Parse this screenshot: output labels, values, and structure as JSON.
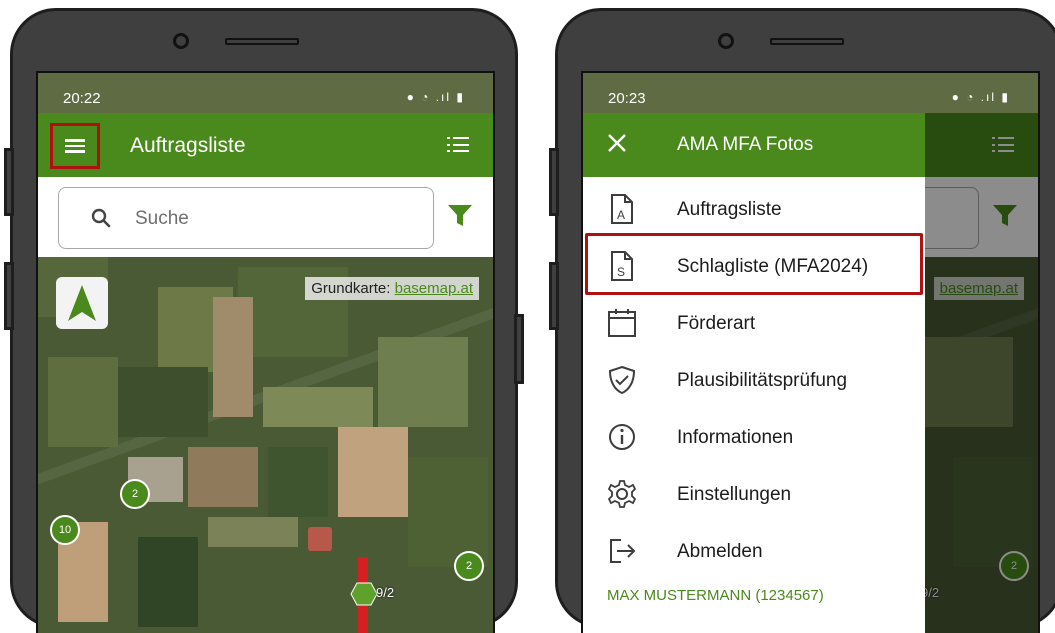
{
  "left_screen": {
    "status_time": "20:22",
    "status_icons": "● ◔ .ıl ▮",
    "app_title": "Auftragsliste",
    "search_placeholder": "Suche",
    "attribution_prefix": "Grundkarte: ",
    "attribution_link": "basemap.at",
    "clusters": [
      "2",
      "10",
      "2"
    ],
    "marker_label": "9/2"
  },
  "right_screen": {
    "status_time": "20:23",
    "status_icons": "● ◔ .ıl ▮",
    "drawer_title": "AMA MFA Fotos",
    "menu_items": [
      {
        "label": "Auftragsliste",
        "icon": "document-a-icon"
      },
      {
        "label": "Schlagliste (MFA2024)",
        "icon": "document-s-icon"
      },
      {
        "label": "Förderart",
        "icon": "calendar-icon"
      },
      {
        "label": "Plausibilitätsprüfung",
        "icon": "shield-check-icon"
      },
      {
        "label": "Informationen",
        "icon": "info-icon"
      },
      {
        "label": "Einstellungen",
        "icon": "gear-icon"
      },
      {
        "label": "Abmelden",
        "icon": "logout-icon"
      }
    ],
    "user": "MAX MUSTERMANN (1234567)",
    "attribution_link": "basemap.at",
    "cluster": "2",
    "marker_label": "9/2"
  },
  "colors": {
    "app_green": "#4a8a1c",
    "highlight_red": "#b01010"
  }
}
